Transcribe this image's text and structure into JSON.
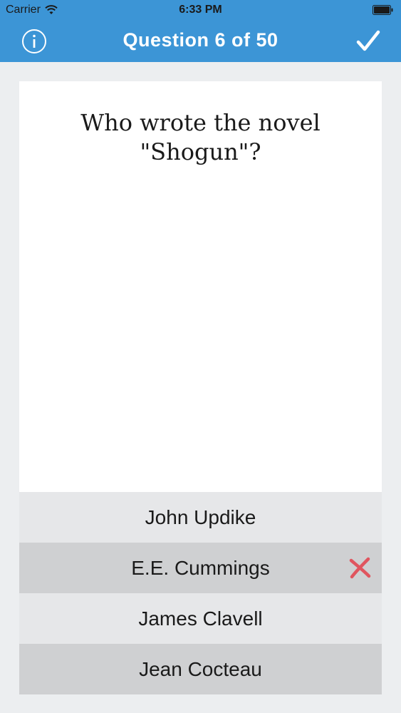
{
  "status_bar": {
    "carrier": "Carrier",
    "time": "6:33 PM"
  },
  "nav": {
    "title": "Question 6 of 50",
    "info_icon": "info-icon",
    "done_icon": "checkmark-icon"
  },
  "question": {
    "text": "Who wrote the novel \"Shogun\"?"
  },
  "answers": [
    {
      "label": "John Updike",
      "state": "normal"
    },
    {
      "label": "E.E. Cummings",
      "state": "wrong"
    },
    {
      "label": "James Clavell",
      "state": "normal"
    },
    {
      "label": "Jean Cocteau",
      "state": "normal"
    }
  ],
  "colors": {
    "header": "#3c95d6",
    "background": "#eceef0",
    "wrong_mark": "#e0555f"
  }
}
